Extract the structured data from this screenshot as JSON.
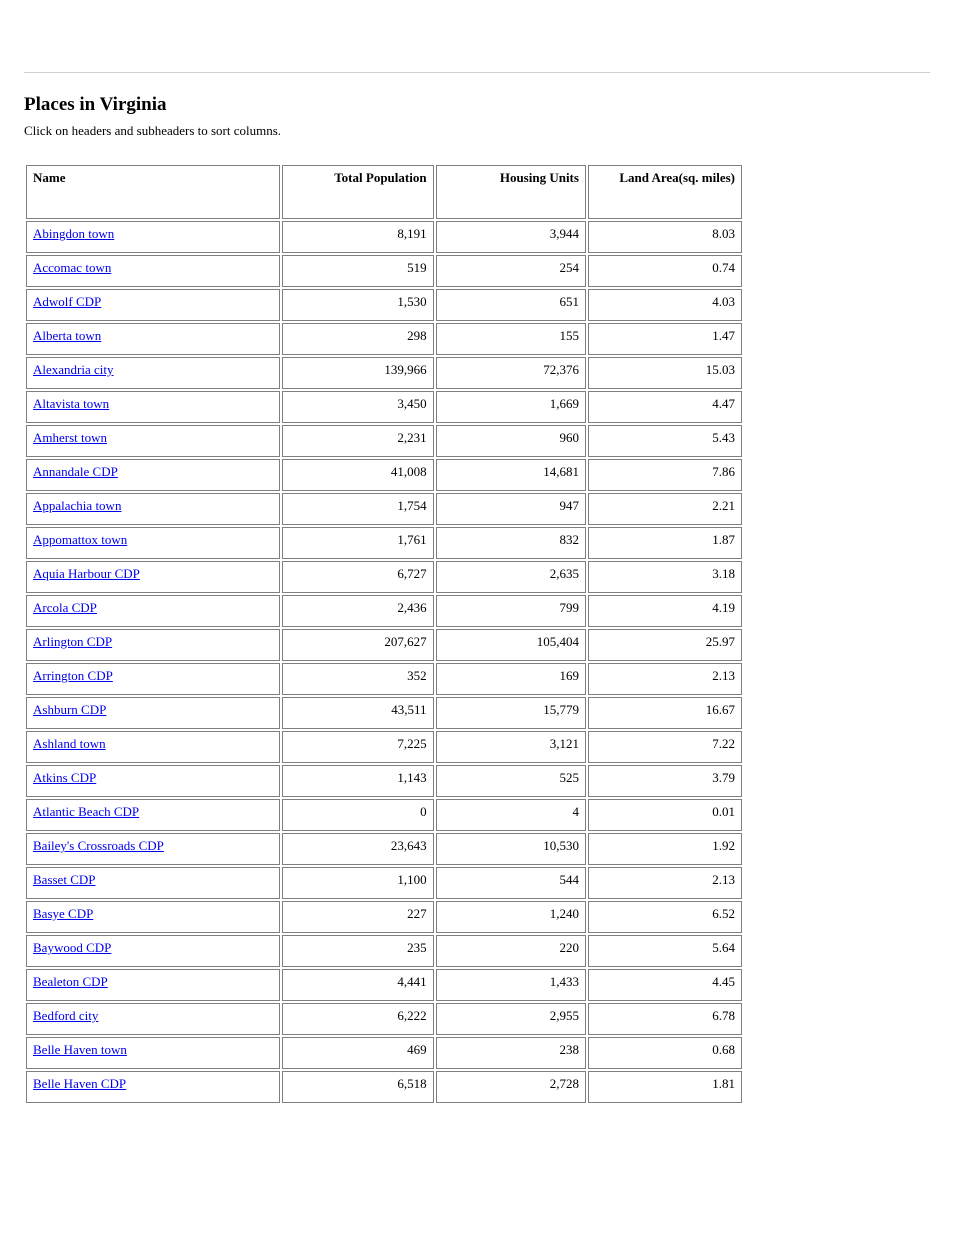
{
  "header": {
    "title": "Places in Virginia",
    "subtitle": "Click on headers and subheaders to sort columns."
  },
  "table": {
    "columns": [
      {
        "key": "name",
        "label": "Name"
      },
      {
        "key": "pop",
        "label": "Total Population"
      },
      {
        "key": "house",
        "label": "Housing Units"
      },
      {
        "key": "land",
        "label": "Land Area(sq. miles)"
      }
    ],
    "rows": [
      {
        "name": "Abingdon town",
        "pop": "8,191",
        "house": "3,944",
        "land": "8.03"
      },
      {
        "name": "Accomac town",
        "pop": "519",
        "house": "254",
        "land": "0.74"
      },
      {
        "name": "Adwolf CDP",
        "pop": "1,530",
        "house": "651",
        "land": "4.03"
      },
      {
        "name": "Alberta town",
        "pop": "298",
        "house": "155",
        "land": "1.47"
      },
      {
        "name": "Alexandria city",
        "pop": "139,966",
        "house": "72,376",
        "land": "15.03"
      },
      {
        "name": "Altavista town",
        "pop": "3,450",
        "house": "1,669",
        "land": "4.47"
      },
      {
        "name": "Amherst town",
        "pop": "2,231",
        "house": "960",
        "land": "5.43"
      },
      {
        "name": "Annandale CDP",
        "pop": "41,008",
        "house": "14,681",
        "land": "7.86"
      },
      {
        "name": "Appalachia town",
        "pop": "1,754",
        "house": "947",
        "land": "2.21"
      },
      {
        "name": "Appomattox town",
        "pop": "1,761",
        "house": "832",
        "land": "1.87"
      },
      {
        "name": "Aquia Harbour CDP",
        "pop": "6,727",
        "house": "2,635",
        "land": "3.18"
      },
      {
        "name": "Arcola CDP",
        "pop": "2,436",
        "house": "799",
        "land": "4.19"
      },
      {
        "name": "Arlington CDP",
        "pop": "207,627",
        "house": "105,404",
        "land": "25.97"
      },
      {
        "name": "Arrington CDP",
        "pop": "352",
        "house": "169",
        "land": "2.13"
      },
      {
        "name": "Ashburn CDP",
        "pop": "43,511",
        "house": "15,779",
        "land": "16.67"
      },
      {
        "name": "Ashland town",
        "pop": "7,225",
        "house": "3,121",
        "land": "7.22"
      },
      {
        "name": "Atkins CDP",
        "pop": "1,143",
        "house": "525",
        "land": "3.79"
      },
      {
        "name": "Atlantic Beach CDP",
        "pop": "0",
        "house": "4",
        "land": "0.01"
      },
      {
        "name": "Bailey's Crossroads CDP",
        "pop": "23,643",
        "house": "10,530",
        "land": "1.92"
      },
      {
        "name": "Basset CDP",
        "pop": "1,100",
        "house": "544",
        "land": "2.13"
      },
      {
        "name": "Basye CDP",
        "pop": "227",
        "house": "1,240",
        "land": "6.52"
      },
      {
        "name": "Baywood CDP",
        "pop": "235",
        "house": "220",
        "land": "5.64"
      },
      {
        "name": "Bealeton CDP",
        "pop": "4,441",
        "house": "1,433",
        "land": "4.45"
      },
      {
        "name": "Bedford city",
        "pop": "6,222",
        "house": "2,955",
        "land": "6.78"
      },
      {
        "name": "Belle Haven town",
        "pop": "469",
        "house": "238",
        "land": "0.68"
      },
      {
        "name": "Belle Haven CDP",
        "pop": "6,518",
        "house": "2,728",
        "land": "1.81"
      }
    ]
  }
}
